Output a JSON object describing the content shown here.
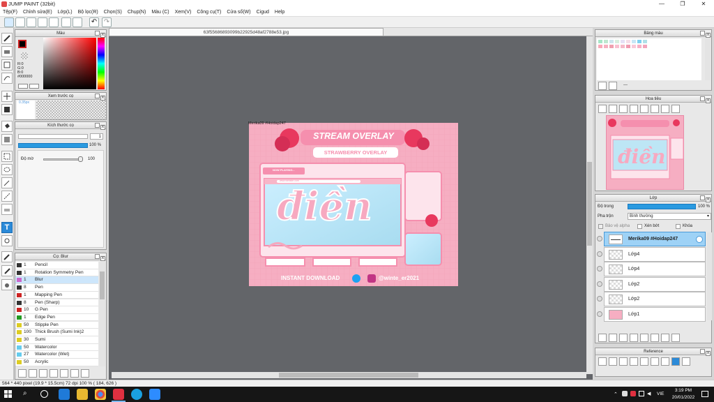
{
  "window": {
    "title": "JUMP PAINT (32bit)"
  },
  "menu": [
    "Tệp(F)",
    "Chỉnh sửa(E)",
    "Lớp(L)",
    "Bộ lọc(R)",
    "Chọn(S)",
    "Chụp(N)",
    "Màu (C)",
    "Xem(V)",
    "Công cụ(T)",
    "Cửa sổ(W)",
    "Cigud",
    "Help"
  ],
  "document": {
    "tab_title": "63f55686893099b22925d48af2788e53.jpg"
  },
  "color_panel": {
    "title": "Màu",
    "r": "R:0",
    "g": "G:0",
    "b": "B:0",
    "hex": "#000000"
  },
  "preview_panel": {
    "title": "Xem trước cọ",
    "size": "0.35px"
  },
  "brush_size_panel": {
    "title": "Kích thước cọ",
    "size_value": "1",
    "opacity_pct": "100 %",
    "density_label": "Độ mờ",
    "density_value": "100"
  },
  "brush_list": {
    "title": "Cọ: Blur",
    "items": [
      {
        "size": "1",
        "name": "Pencil",
        "color": "#333333"
      },
      {
        "size": "1",
        "name": "Rotation Symmetry Pen",
        "color": "#333333"
      },
      {
        "size": "1",
        "name": "Blur",
        "color": "#cc66cc"
      },
      {
        "size": "8",
        "name": "Pen",
        "color": "#333333"
      },
      {
        "size": "1",
        "name": "Mapping Pen",
        "color": "#cc2222"
      },
      {
        "size": "8",
        "name": "Pen (Sharp)",
        "color": "#333333"
      },
      {
        "size": "10",
        "name": "G Pen",
        "color": "#cc2222"
      },
      {
        "size": "1",
        "name": "Edge Pen",
        "color": "#229922"
      },
      {
        "size": "50",
        "name": "Stipple Pen",
        "color": "#ddcc22"
      },
      {
        "size": "100",
        "name": "Thick Brush (Sumi Ink)2",
        "color": "#ddcc22"
      },
      {
        "size": "30",
        "name": "Sumi",
        "color": "#ddcc22"
      },
      {
        "size": "50",
        "name": "Watercolor",
        "color": "#66ccee"
      },
      {
        "size": "27",
        "name": "Watercolor (Wet)",
        "color": "#66ccee"
      },
      {
        "size": "50",
        "name": "Acrylic",
        "color": "#ddcc22"
      }
    ]
  },
  "palette_panel": {
    "title": "Bảng màu",
    "footer": "---"
  },
  "navigator_panel": {
    "title": "Hoa tiêu"
  },
  "layer_panel": {
    "title": "Lớp",
    "opacity_label": "Độ trong",
    "opacity_value": "100 %",
    "blend_label": "Pha trộn",
    "blend_value": "Bình thường",
    "protect_alpha": "Bảo vệ alpha",
    "clipping": "Xén bớt",
    "lock": "Khóa",
    "layers": [
      {
        "name": "Merika09 #Hoidap247",
        "selected": true
      },
      {
        "name": "Lớp4",
        "selected": false
      },
      {
        "name": "Lớp4",
        "selected": false
      },
      {
        "name": "Lớp2",
        "selected": false
      },
      {
        "name": "Lớp2",
        "selected": false
      },
      {
        "name": "Lớp1",
        "selected": false
      }
    ]
  },
  "reference_panel": {
    "title": "Reference"
  },
  "artwork": {
    "watermark": "Merika09 #Hoidap247",
    "headline": "STREAM OVERLAY",
    "subheadline": "STRAWBERRY OVERLAY",
    "now_playing": "NOW PLAYING...",
    "url": "www.website.com",
    "script_word": "điền",
    "footer_left": "INSTANT DOWNLOAD",
    "footer_right": "@winte_er2021"
  },
  "status": {
    "text": "564 * 440 pixel   (19.9 * 15.5cm)   72 dpi   100 %   ( 184, 626 )"
  },
  "taskbar": {
    "time": "3:19 PM",
    "date": "20/01/2022",
    "lang": "VIE"
  }
}
